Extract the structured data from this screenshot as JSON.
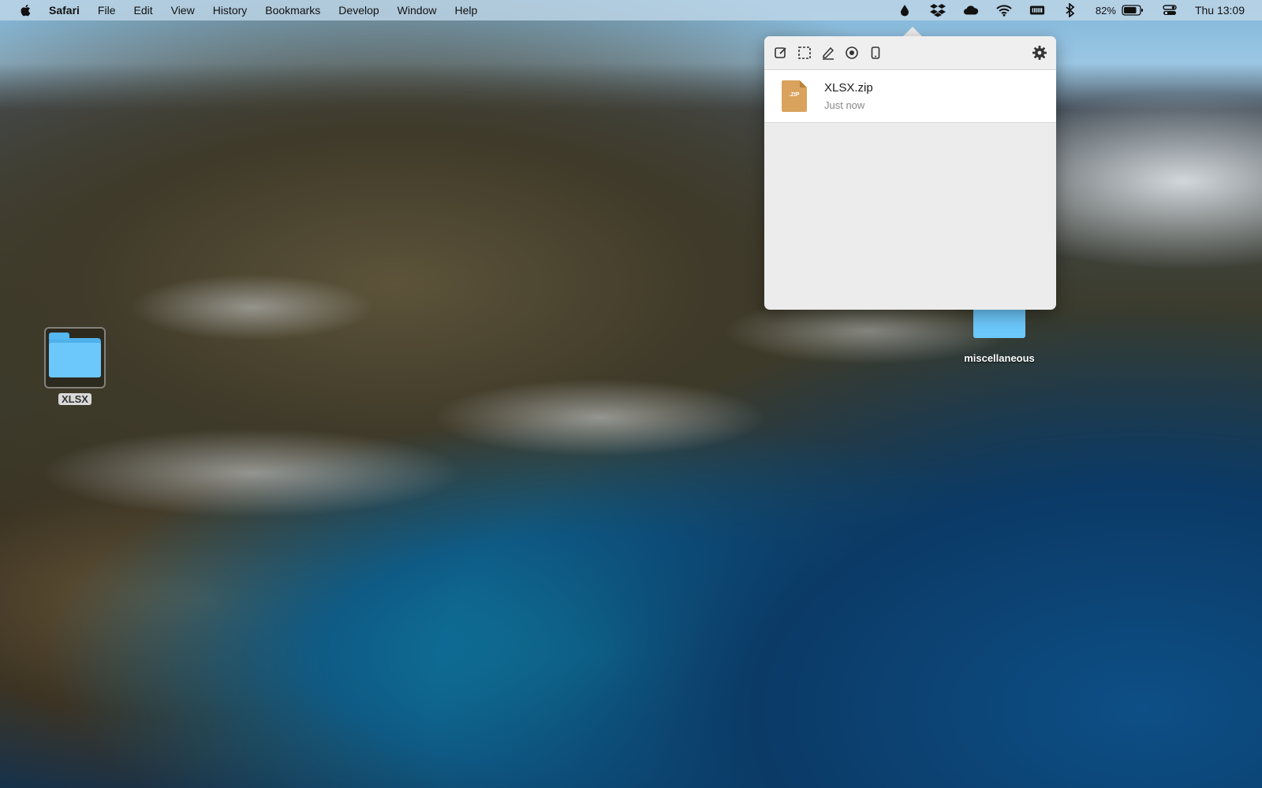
{
  "menubar": {
    "app_name": "Safari",
    "items": [
      "File",
      "Edit",
      "View",
      "History",
      "Bookmarks",
      "Develop",
      "Window",
      "Help"
    ],
    "battery_percent": "82%",
    "clock": "Thu 13:09",
    "status_icons": [
      "drop-icon",
      "dropbox-icon",
      "cloud-icon",
      "wifi-icon",
      "keyboard-icon",
      "bluetooth-icon",
      "battery-icon",
      "control-center-icon"
    ]
  },
  "popover": {
    "tools": [
      "edit-icon",
      "selection-icon",
      "pen-icon",
      "record-icon",
      "device-icon"
    ],
    "settings_icon": "gear-icon",
    "files": [
      {
        "name": "XLSX.zip",
        "time": "Just now",
        "badge": ".ZIP"
      }
    ]
  },
  "desktop": {
    "items": [
      {
        "label": "XLSX",
        "selected": true
      },
      {
        "label": "miscellaneous",
        "selected": false
      }
    ]
  },
  "colors": {
    "folder": "#6cc8fb",
    "zip": "#d9a35d",
    "menubar": "#bed6e6"
  }
}
